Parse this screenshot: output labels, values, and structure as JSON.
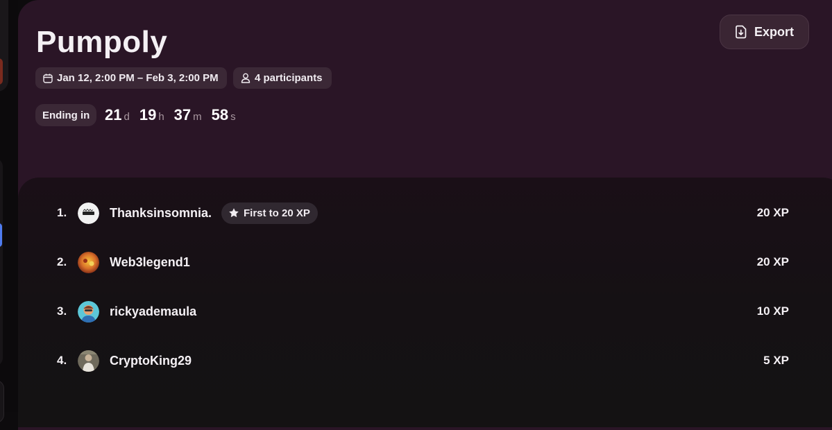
{
  "header": {
    "title": "Pumpoly",
    "export_label": "Export",
    "date_range": "Jan 12, 2:00 PM – Feb 3, 2:00 PM",
    "participants": "4 participants"
  },
  "countdown": {
    "label": "Ending in",
    "days": "21",
    "days_unit": "d",
    "hours": "19",
    "hours_unit": "h",
    "minutes": "37",
    "minutes_unit": "m",
    "seconds": "58",
    "seconds_unit": "s"
  },
  "leaderboard": [
    {
      "rank": "1.",
      "name": "Thanksinsomnia.",
      "badge": "First to 20 XP",
      "xp": "20 XP"
    },
    {
      "rank": "2.",
      "name": "Web3legend1",
      "xp": "20 XP"
    },
    {
      "rank": "3.",
      "name": "rickyademaula",
      "xp": "10 XP"
    },
    {
      "rank": "4.",
      "name": "CryptoKing29",
      "xp": "5 XP"
    }
  ],
  "icons": {
    "export": "file-download-icon",
    "date": "calendar-icon",
    "participants": "user-icon",
    "badge": "star-icon"
  }
}
